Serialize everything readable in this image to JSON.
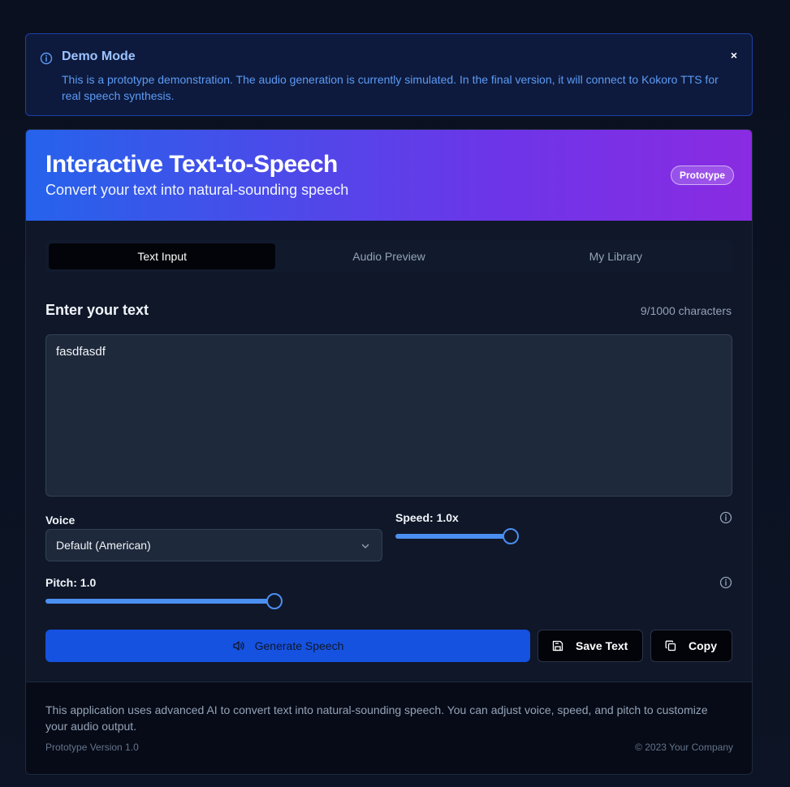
{
  "banner": {
    "icon": "info-icon",
    "title": "Demo Mode",
    "text": "This is a prototype demonstration. The audio generation is currently simulated. In the final version, it will connect to Kokoro TTS for real speech synthesis.",
    "close_label": "×"
  },
  "header": {
    "title": "Interactive Text-to-Speech",
    "subtitle": "Convert your text into natural-sounding speech",
    "badge": "Prototype"
  },
  "tabs": [
    {
      "label": "Text Input",
      "active": true
    },
    {
      "label": "Audio Preview",
      "active": false
    },
    {
      "label": "My Library",
      "active": false
    }
  ],
  "editor": {
    "title": "Enter your text",
    "char_count": "9/1000 characters",
    "value": "fasdfasdf"
  },
  "controls": {
    "voice_label": "Voice",
    "voice_value": "Default (American)",
    "speed_label": "Speed: 1.0x",
    "speed_fraction": 0.95,
    "pitch_label": "Pitch: 1.0",
    "pitch_fraction": 0.97
  },
  "actions": {
    "generate_label": "Generate Speech",
    "save_label": "Save Text",
    "copy_label": "Copy"
  },
  "footer": {
    "description": "This application uses advanced AI to convert text into natural-sounding speech. You can adjust voice, speed, and pitch to customize your audio output.",
    "version": "Prototype Version 1.0",
    "copyright": "© 2023 Your Company"
  },
  "colors": {
    "accent": "#4b8ff0",
    "primary_button": "#1652e0",
    "gradient_start": "#2563eb",
    "gradient_end": "#8a2be2"
  }
}
